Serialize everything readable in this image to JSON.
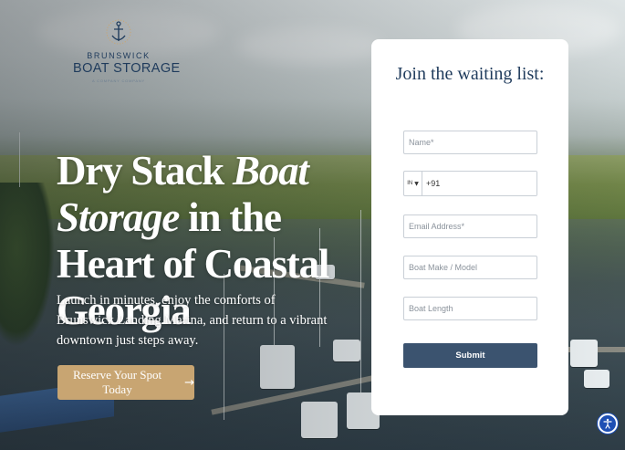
{
  "logo": {
    "name_top": "BRUNSWICK",
    "name_main": "BOAT STORAGE",
    "name_sub": "A COMPANY COMPANY",
    "icon": "anchor-icon",
    "color": "#1f3b5c"
  },
  "hero": {
    "title_part1": "Dry Stack ",
    "title_italic1": "Boat",
    "title_italic2": "Storage",
    "title_part2": " in the Heart of Coastal Georgia",
    "subtitle": "Launch in minutes, enjoy the comforts of Brunswick Landing Marina, and return to a vibrant downtown just steps away.",
    "cta_label": "Reserve Your Spot Today",
    "cta_icon": "arrow-right-icon",
    "cta_color": "#c8a572"
  },
  "form": {
    "title": "Join the waiting list:",
    "name_placeholder": "Name*",
    "phone_country": "IN",
    "phone_value": "+91",
    "email_placeholder": "Email Address*",
    "boat_make_placeholder": "Boat Make / Model",
    "boat_length_placeholder": "Boat Length",
    "submit_label": "Submit",
    "submit_color": "#3b536f"
  },
  "accessibility": {
    "icon": "accessibility-icon",
    "color": "#1e4fb4"
  }
}
